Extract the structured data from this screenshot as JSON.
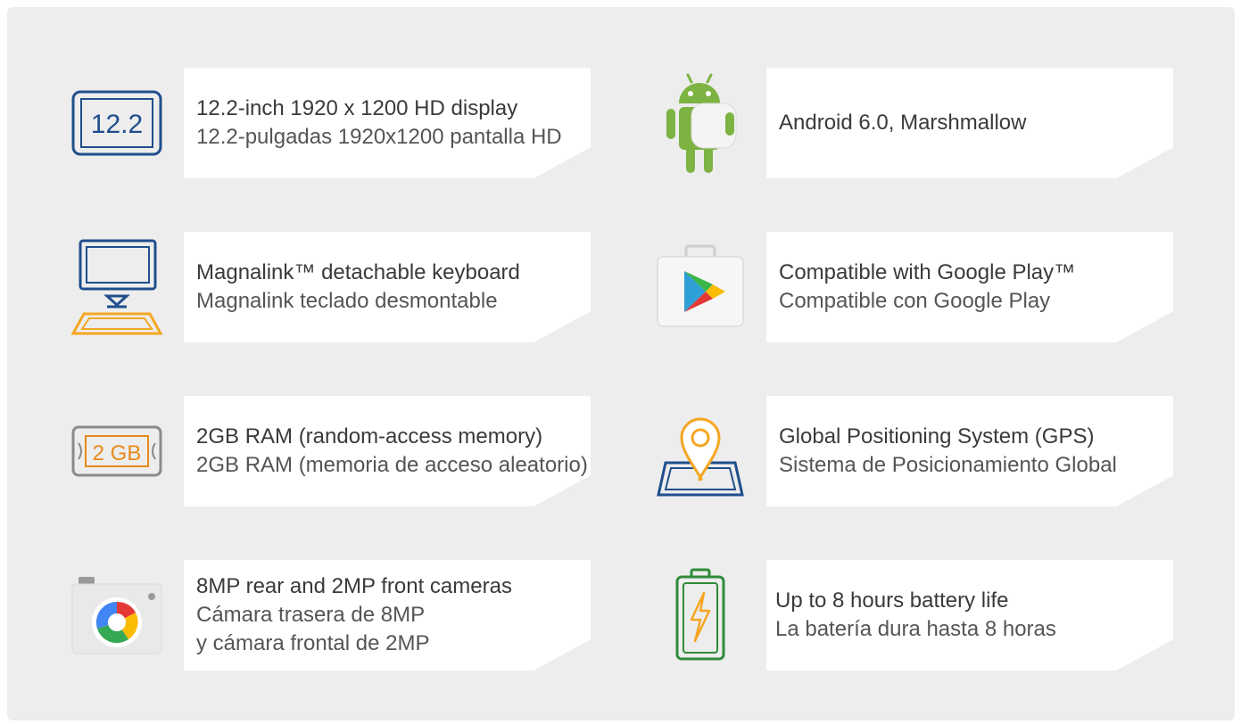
{
  "features": {
    "display": {
      "icon": "display-size-icon",
      "icon_text": "12.2",
      "title": "12.2-inch 1920 x 1200 HD display",
      "subtitle": "12.2-pulgadas 1920x1200 pantalla HD",
      "accent": "#1f4e8c"
    },
    "android": {
      "icon": "android-marshmallow-icon",
      "title": "Android 6.0, Marshmallow",
      "accent": "#7cb342"
    },
    "keyboard": {
      "icon": "detachable-keyboard-icon",
      "title": "Magnalink™ detachable keyboard",
      "subtitle": "Magnalink teclado desmontable",
      "accent": "#1f4e8c",
      "accent_secondary": "#f5a623"
    },
    "google_play": {
      "icon": "google-play-icon",
      "title": "Compatible with Google Play™",
      "subtitle": "Compatible con Google Play"
    },
    "ram": {
      "icon": "memory-chip-icon",
      "icon_text": "2 GB",
      "title": "2GB RAM (random-access memory)",
      "subtitle": "2GB RAM (memoria de acceso aleatorio)",
      "accent": "#e88a1a"
    },
    "gps": {
      "icon": "map-pin-icon",
      "title": "Global Positioning System (GPS)",
      "subtitle": "Sistema de Posicionamiento Global",
      "accent": "#1f4e8c",
      "accent_secondary": "#f5a623"
    },
    "camera": {
      "icon": "camera-icon",
      "title": "8MP rear and 2MP front cameras",
      "subtitle_line1": "Cámara trasera de 8MP",
      "subtitle_line2": "y cámara frontal de 2MP"
    },
    "battery": {
      "icon": "battery-bolt-icon",
      "title": "Up to 8 hours battery life",
      "subtitle": "La batería dura hasta 8 horas",
      "accent": "#2e8b3a",
      "accent_secondary": "#f5a623"
    }
  }
}
